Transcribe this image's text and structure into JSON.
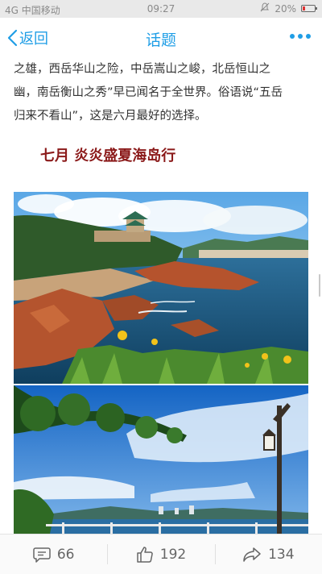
{
  "status_bar": {
    "carrier": "中国移动",
    "carrier_prefix": "4G",
    "time": "09:27",
    "battery_text": "20%",
    "battery_level": 0.2
  },
  "nav": {
    "back_label": "返回",
    "title": "话题",
    "accent_color": "#1f9ee6"
  },
  "article": {
    "lines": [
      "之雄，西岳华山之险，中岳嵩山之峻，北岳恒山之",
      "幽，南岳衡山之秀”早已闻名于全世界。俗语说“五岳",
      "归来不看山”，这是六月最好的选择。"
    ],
    "section_title": "七月 炎炎盛夏海岛行",
    "section_title_color": "#8b1a1a"
  },
  "actions": {
    "comments": "66",
    "likes": "192",
    "shares": "134"
  }
}
